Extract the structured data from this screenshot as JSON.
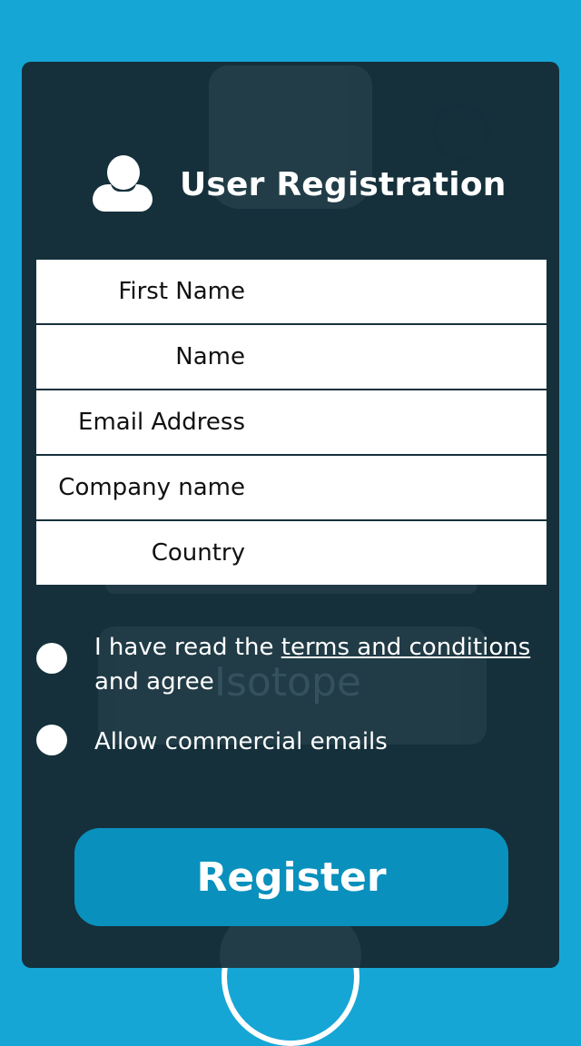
{
  "header": {
    "title": "User Registration",
    "icon": "user-icon"
  },
  "form": {
    "fields": [
      {
        "label": "First Name",
        "value": ""
      },
      {
        "label": "Name",
        "value": ""
      },
      {
        "label": "Email Address",
        "value": ""
      },
      {
        "label": "Company name",
        "value": ""
      },
      {
        "label": "Country",
        "value": ""
      }
    ]
  },
  "terms": {
    "prefix": "I have read the ",
    "link": "terms and conditions",
    "suffix": "and agree",
    "checked": false
  },
  "emails": {
    "label": "Allow commercial emails",
    "checked": false
  },
  "background": {
    "watermark": "Isotope"
  },
  "actions": {
    "register_label": "Register"
  },
  "colors": {
    "page_background": "#16a6d6",
    "card_background": "#15303b",
    "button": "#0a90bd",
    "text_light": "#ffffff"
  }
}
